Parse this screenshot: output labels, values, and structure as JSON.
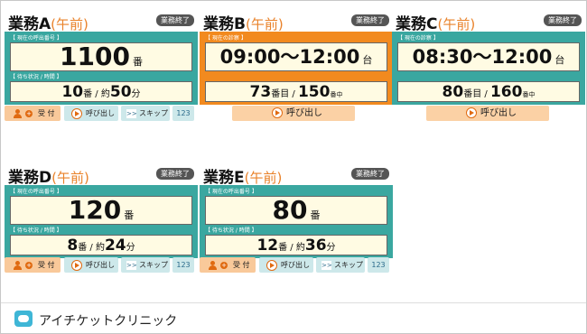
{
  "panels": {
    "a": {
      "name": "業務A",
      "ampm": "(午前)",
      "status": "業務終了",
      "label1": "【 現在の呼出番号 】",
      "num": "1100",
      "num_unit": "番",
      "label2": "【 待ち状況 / 時間 】",
      "wait_num": "10",
      "wait_unit": "番 / 約",
      "time": "50",
      "time_unit": "分"
    },
    "b": {
      "name": "業務B",
      "ampm": "(午前)",
      "status": "業務終了",
      "label1": "【 現在の診察 】",
      "time_range": "09:00〜12:00",
      "range_unit": "台",
      "pos": "73",
      "pos_unit": "番目 / ",
      "total": "150",
      "total_unit": "番中",
      "call": "呼び出し"
    },
    "c": {
      "name": "業務C",
      "ampm": "(午前)",
      "status": "業務終了",
      "label1": "【 現在の診察 】",
      "time_range": "08:30〜12:00",
      "range_unit": "台",
      "pos": "80",
      "pos_unit": "番目 / ",
      "total": "160",
      "total_unit": "番中",
      "call": "呼び出し"
    },
    "d": {
      "name": "業務D",
      "ampm": "(午前)",
      "status": "業務終了",
      "label1": "【 現在の呼出番号 】",
      "num": "120",
      "num_unit": "番",
      "label2": "【 待ち状況 / 時間 】",
      "wait_num": "8",
      "wait_unit": "番 / 約",
      "time": "24",
      "time_unit": "分"
    },
    "e": {
      "name": "業務E",
      "ampm": "(午前)",
      "status": "業務終了",
      "label1": "【 現在の呼出番号 】",
      "num": "80",
      "num_unit": "番",
      "label2": "【 待ち状況 / 時間 】",
      "wait_num": "12",
      "wait_unit": "番 / 約",
      "time": "36",
      "time_unit": "分"
    }
  },
  "buttons": {
    "receive": "受 付",
    "plus": "+",
    "call": "呼び出し",
    "skip_icon": ">>",
    "skip": "スキップ",
    "num": "123"
  },
  "colors": {
    "teal": "#3aa7a0",
    "orange": "#f28a1f",
    "accent": "#e9822a"
  },
  "footer": {
    "brand": "アイチケットクリニック"
  }
}
